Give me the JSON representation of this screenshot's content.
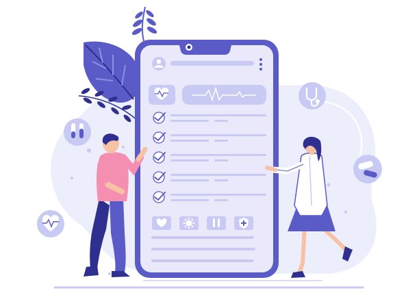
{
  "colors": {
    "primary": "#5a5bc6",
    "primary_dark": "#2e2f8f",
    "light": "#c9caf3",
    "lighter": "#e6e6fa",
    "blob": "#e9e9fb",
    "pink": "#f48fb1",
    "skin": "#f6c2a6",
    "white": "#ffffff"
  },
  "checklist": [
    {
      "checked": true
    },
    {
      "checked": true
    },
    {
      "checked": true
    },
    {
      "checked": true
    },
    {
      "checked": true
    }
  ],
  "icons": [
    "heart-icon",
    "virus-icon",
    "test-tube-icon",
    "shield-icon"
  ],
  "floating_icons": [
    "stethoscope-icon",
    "test-tubes-icon",
    "pills-icon",
    "heart-rate-icon"
  ]
}
